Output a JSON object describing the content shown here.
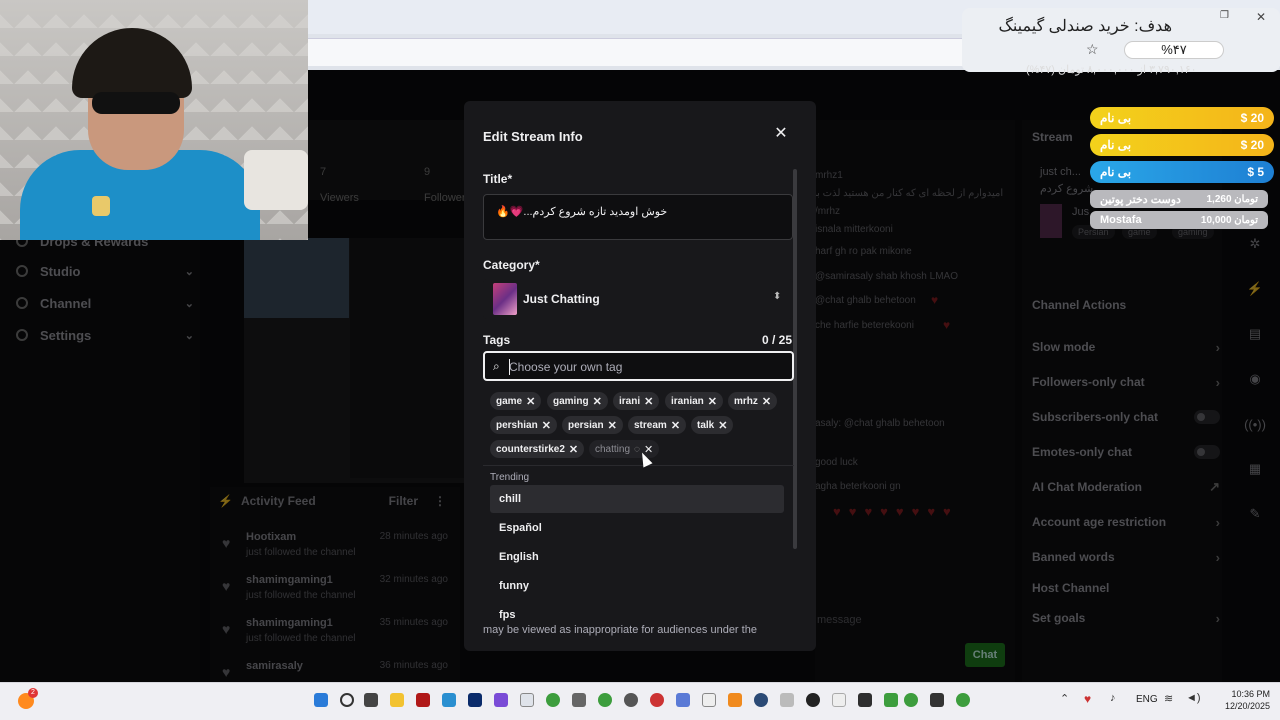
{
  "goal": {
    "title": "هدف: خرید صندلی گیمینگ",
    "percent": "%۴۷",
    "progress": 0.47,
    "subtext": "۳,۷۹۰,۱۶۰ از ۸,۰۰۰,۰۰۰ تومان (۴۷%)"
  },
  "donations": [
    {
      "name": "بی نام",
      "amount": "$ 20"
    },
    {
      "name": "بی نام",
      "amount": "$ 20"
    },
    {
      "name": "بی نام",
      "amount": "$ 5"
    },
    {
      "name": "دوست دختر پوتین",
      "amount": "1,260 تومان"
    },
    {
      "name": "Mostafa",
      "amount": "10,000 تومان"
    }
  ],
  "nav": {
    "drops": "Drops & Rewards",
    "studio": "Studio",
    "channel": "Channel",
    "settings": "Settings"
  },
  "stats": {
    "viewers_num": "7",
    "viewers_label": "Viewers",
    "followers_num": "9",
    "followers_label": "Followers"
  },
  "activity": {
    "title": "Activity Feed",
    "filter": "Filter",
    "items": [
      {
        "name": "Hootixam",
        "sub": "just followed the channel",
        "time": "28 minutes ago"
      },
      {
        "name": "shamimgaming1",
        "sub": "just followed the channel",
        "time": "32 minutes ago"
      },
      {
        "name": "shamimgaming1",
        "sub": "just followed the channel",
        "time": "35 minutes ago"
      },
      {
        "name": "samirasaly",
        "sub": "just followed the channel",
        "time": "36 minutes ago"
      }
    ]
  },
  "chat": {
    "lines": [
      "mrhz1",
      "امیدوارم از لحظه ای که کنار من هستید لذت ببرید :",
      "/mrhz",
      "isnala mitterkooni",
      "harf gh ro pak mikone",
      "@samirasaly shab khosh LMAO",
      "@chat ghalb behetoon",
      "che harfie beterekooni",
      "asaly: @chat ghalb behetoon",
      "good luck",
      "agha beterkooni gn"
    ],
    "placeholder": "message",
    "button": "Chat"
  },
  "stream_card": {
    "title": "Stream",
    "line1": "just ch...",
    "line2": "شروع کردم",
    "line3": "Jus",
    "tags": [
      "Persian",
      "game",
      "gaming"
    ]
  },
  "channel_actions": {
    "title": "Channel Actions",
    "items": [
      {
        "label": "Slow mode",
        "kind": "chevron"
      },
      {
        "label": "Followers-only chat",
        "kind": "chevron"
      },
      {
        "label": "Subscribers-only chat",
        "kind": "toggle"
      },
      {
        "label": "Emotes-only chat",
        "kind": "toggle"
      },
      {
        "label": "AI Chat Moderation",
        "kind": "external"
      },
      {
        "label": "Account age restriction",
        "kind": "chevron"
      },
      {
        "label": "Banned words",
        "kind": "chevron"
      },
      {
        "label": "Host Channel",
        "kind": "none"
      },
      {
        "label": "Set goals",
        "kind": "chevron"
      }
    ]
  },
  "modal": {
    "title": "Edit Stream Info",
    "title_label": "Title*",
    "title_value": "خوش اومدید تازه شروع کردم...💗🔥",
    "category_label": "Category*",
    "category_value": "Just Chatting",
    "tags_label": "Tags",
    "tags_count": "0 / 25",
    "tag_placeholder": "Choose your own tag",
    "tags": [
      "game",
      "gaming",
      "irani",
      "iranian",
      "mrhz",
      "pershian",
      "persian",
      "stream",
      "talk",
      "counterstirke2"
    ],
    "loading_tag": "chatting",
    "trending_label": "Trending",
    "suggestions": [
      "chill",
      "Español",
      "English",
      "funny",
      "fps"
    ],
    "footer": "may be viewed as inappropriate for audiences under the"
  },
  "taskbar": {
    "lang": "ENG",
    "time": "10:36 PM",
    "date": "12/20/2025",
    "badge": "2"
  }
}
